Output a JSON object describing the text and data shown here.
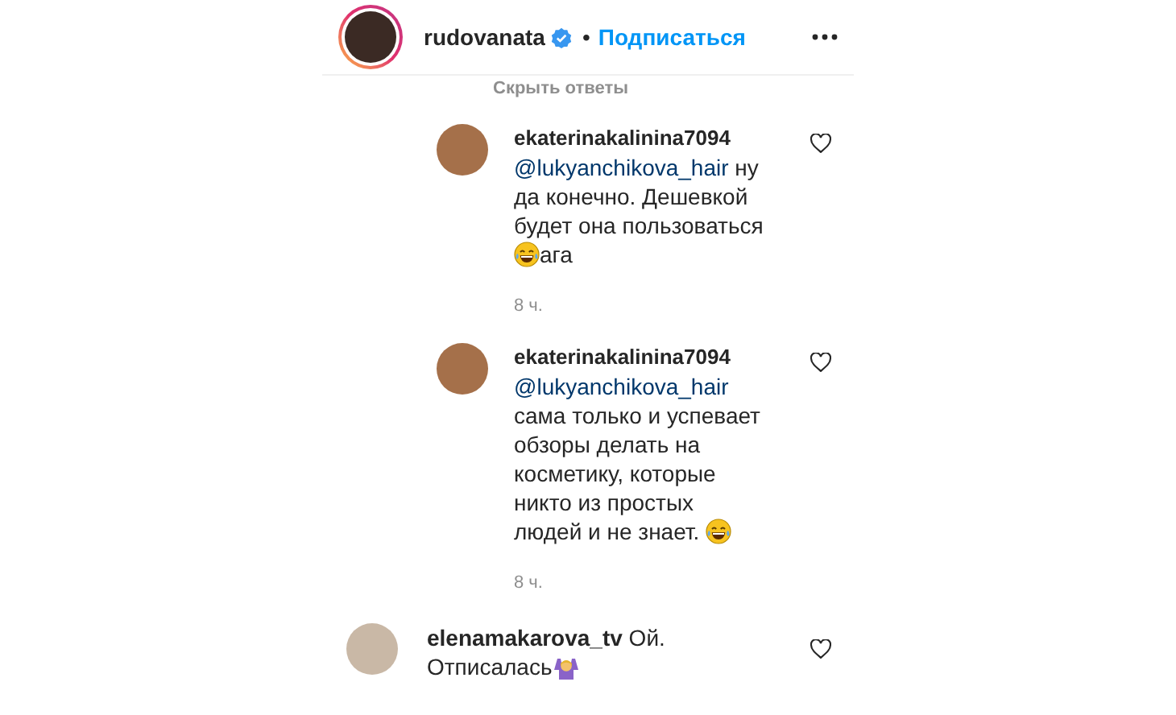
{
  "header": {
    "username": "rudovanata",
    "verified": true,
    "separator": "•",
    "follow": "Подписаться"
  },
  "hide_replies": "Скрыть ответы",
  "replies": [
    {
      "username": "ekaterinakalinina7094",
      "liked": false,
      "lines": [
        [
          {
            "kind": "mention",
            "text": "@lukyanchikova_hair"
          },
          {
            "kind": "text",
            "text": " ну"
          }
        ],
        [
          {
            "kind": "text",
            "text": "да конечно. Дешевкой"
          }
        ],
        [
          {
            "kind": "text",
            "text": "будет она пользоваться"
          }
        ],
        [
          {
            "kind": "emoji"
          },
          {
            "kind": "text",
            "text": "ага"
          }
        ]
      ],
      "time": "8 ч."
    },
    {
      "username": "ekaterinakalinina7094",
      "liked": false,
      "lines": [
        [
          {
            "kind": "mention",
            "text": "@lukyanchikova_hair"
          }
        ],
        [
          {
            "kind": "text",
            "text": "сама только и успевает"
          }
        ],
        [
          {
            "kind": "text",
            "text": "обзоры делать на"
          }
        ],
        [
          {
            "kind": "text",
            "text": "косметику, которые"
          }
        ],
        [
          {
            "kind": "text",
            "text": "никто из простых"
          }
        ],
        [
          {
            "kind": "text",
            "text": "людей и не знает. "
          },
          {
            "kind": "emoji"
          }
        ]
      ],
      "time": "8 ч."
    }
  ],
  "comment": {
    "username": "elenamakarova_tv",
    "liked": false,
    "lines": [
      [
        {
          "kind": "text",
          "text": " Ой."
        }
      ],
      [
        {
          "kind": "text",
          "text": "Отписалась"
        },
        {
          "kind": "shrug"
        }
      ]
    ]
  }
}
